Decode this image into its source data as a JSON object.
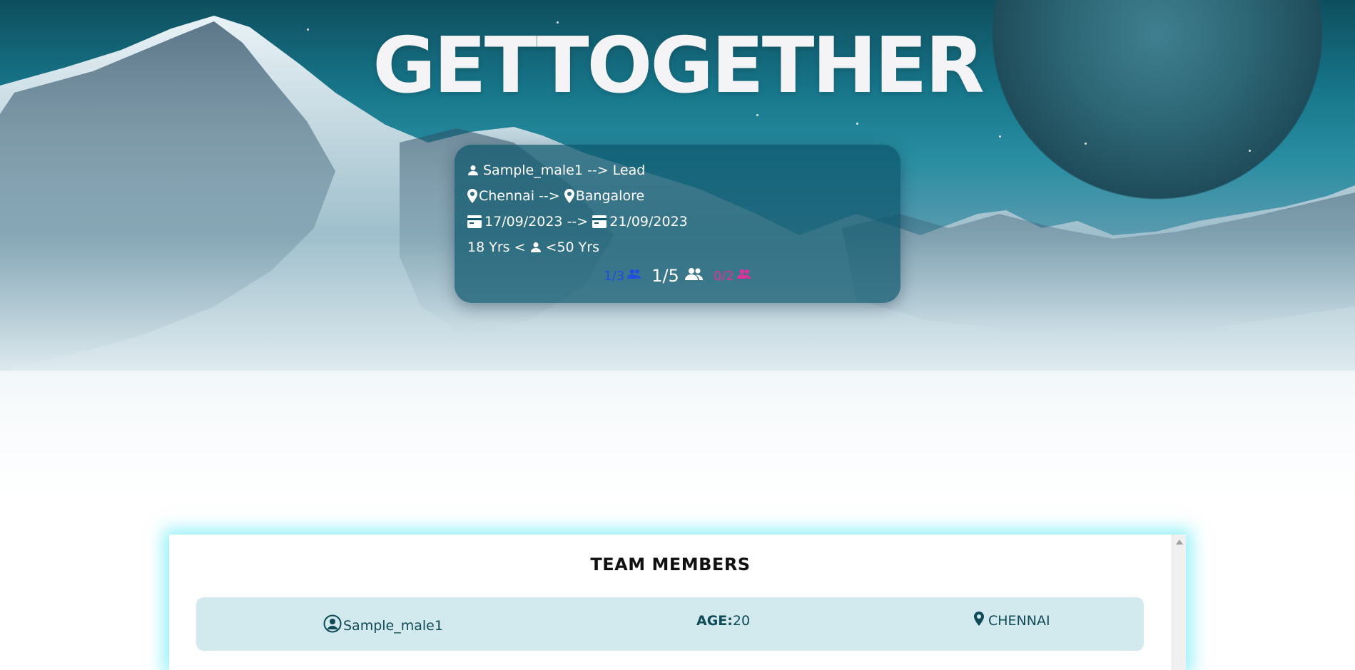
{
  "hero": {
    "title": "GETTOGETHER"
  },
  "trip": {
    "lead_name": "Sample_male1",
    "lead_suffix": "--> Lead",
    "from_city": "Chennai",
    "arrow": "-->",
    "to_city": "Bangalore",
    "start_date": "17/09/2023",
    "end_date": "21/09/2023",
    "age_min": "18 Yrs <",
    "age_max": "<50 Yrs",
    "male_count": "1/3",
    "total_count": "1/5",
    "female_count": "0/2"
  },
  "team": {
    "title": "TEAM MEMBERS",
    "members": [
      {
        "name": "Sample_male1",
        "age_label": "AGE:",
        "age": "20",
        "location": "CHENNAI"
      }
    ]
  },
  "colors": {
    "male": "#1f4fe0",
    "female": "#e0309a",
    "glow": "#3ce6f0"
  }
}
